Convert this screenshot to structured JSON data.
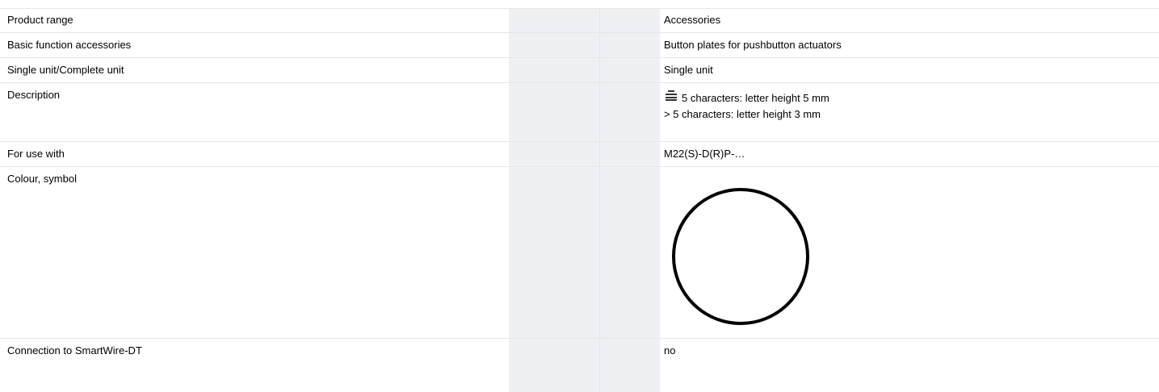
{
  "rows": [
    {
      "label": "Product range",
      "value": "Accessories"
    },
    {
      "label": "Basic function accessories",
      "value": "Button plates for pushbutton actuators"
    },
    {
      "label": "Single unit/Complete unit",
      "value": "Single unit"
    },
    {
      "label": "Description",
      "value_line1": "5 characters: letter height 5 mm",
      "value_line2": "> 5 characters: letter height 3 mm",
      "icon": "label-plate-icon"
    },
    {
      "label": "For use with",
      "value": "M22(S)-D(R)P-…"
    },
    {
      "label": "Colour, symbol",
      "symbol": "circle-symbol"
    },
    {
      "label": "Connection to SmartWire-DT",
      "value": "no"
    }
  ],
  "colors": {
    "heading": "#005eb8",
    "gray_column": "#eef0f4",
    "row_divider": "#e6e6e6"
  }
}
